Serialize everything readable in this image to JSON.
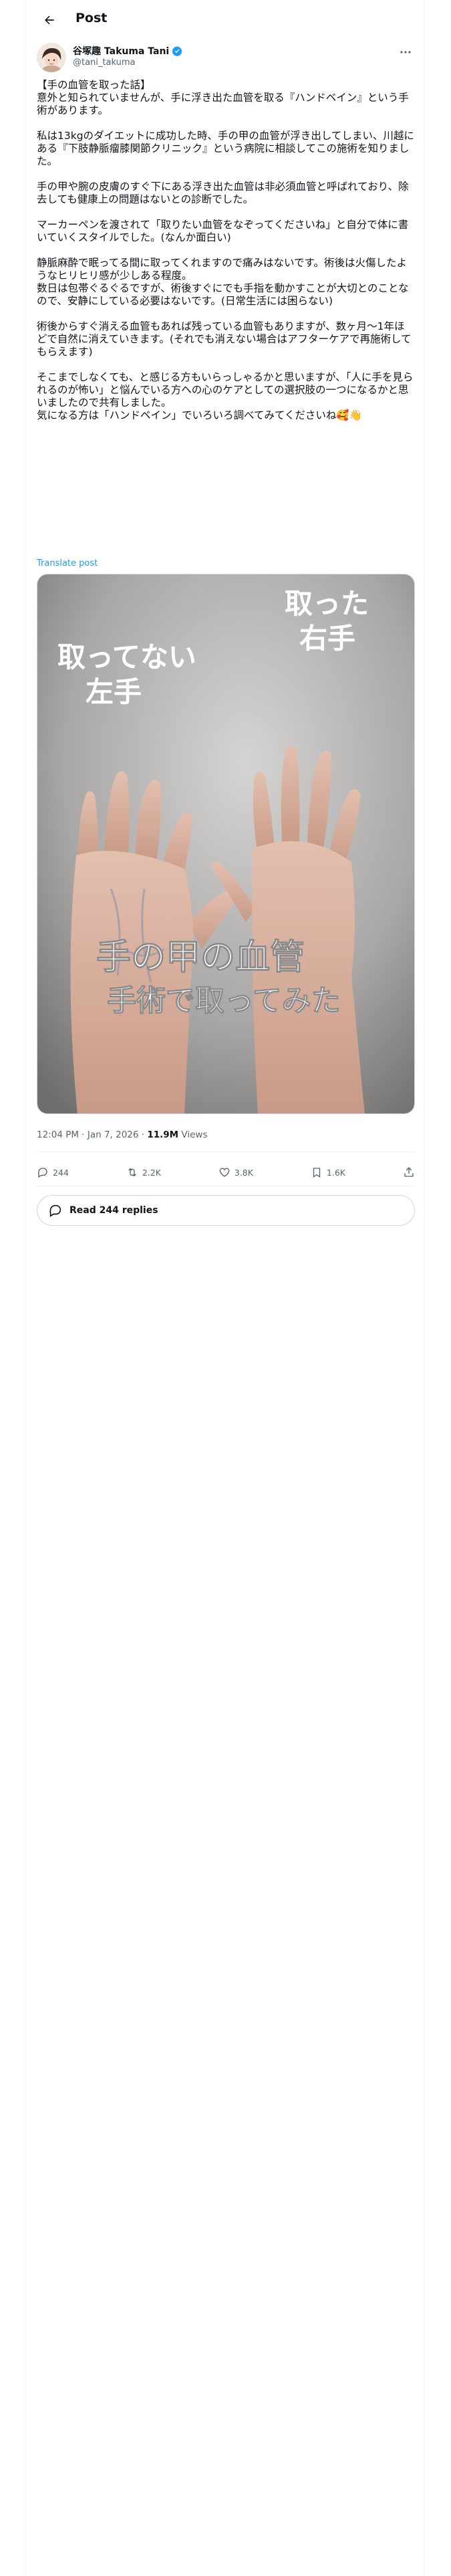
{
  "header": {
    "title": "Post"
  },
  "author": {
    "display_name": "谷塚趣 Takuma Tani",
    "handle": "@tani_takuma",
    "verified": true
  },
  "post": {
    "paragraphs": [
      "【手の血管を取った話】\n意外と知られていませんが、手に浮き出た血管を取る『ハンドベイン』という手術があります。",
      "私は13kgのダイエットに成功した時、手の甲の血管が浮き出してしまい、川越にある『下肢静脈瘤膝関節クリニック』という病院に相談してこの施術を知りました。",
      "手の甲や腕の皮膚のすぐ下にある浮き出た血管は非必須血管と呼ばれており、除去しても健康上の問題はないとの診断でした。",
      "マーカーペンを渡されて「取りたい血管をなぞってくださいね」と自分で体に書いていくスタイルでした。(なんか面白い)",
      "静脈麻酔で眠ってる間に取ってくれますので痛みはないです。術後は火傷したようなヒリヒリ感が少しある程度。\n数日は包帯ぐるぐるですが、術後すぐにでも手指を動かすことが大切とのことなので、安静にしている必要はないです。(日常生活には困らない)",
      "術後からすぐ消える血管もあれば残っている血管もありますが、数ヶ月〜1年ほどで自然に消えていきます。(それでも消えない場合はアフターケアで再施術してもらえます)",
      "そこまでしなくても、と感じる方もいらっしゃるかと思いますが、「人に手を見られるのが怖い」と悩んでいる方への心のケアとしての選択肢の一つになるかと思いましたので共有しました。\n気になる方は「ハンドベイン」でいろいろ調べてみてくださいね🥰👋"
    ],
    "translate_label": "Translate post",
    "image": {
      "left_label_line1": "取ってない",
      "left_label_line2": "左手",
      "right_label_line1": "取った",
      "right_label_line2": "右手",
      "caption_line1": "手の甲の血管",
      "caption_line2": "手術で取ってみた"
    },
    "timestamp": "12:04 PM · Jan 7, 2026",
    "separator": " · ",
    "views_count": "11.9M",
    "views_label": " Views"
  },
  "actions": {
    "replies": "244",
    "reposts": "2.2K",
    "likes": "3.8K",
    "bookmarks": "1.6K"
  },
  "read_replies_label": "Read 244 replies",
  "colors": {
    "accent": "#1d9bf0",
    "text": "#0f1419",
    "muted": "#536471",
    "border": "#cfd9de"
  }
}
